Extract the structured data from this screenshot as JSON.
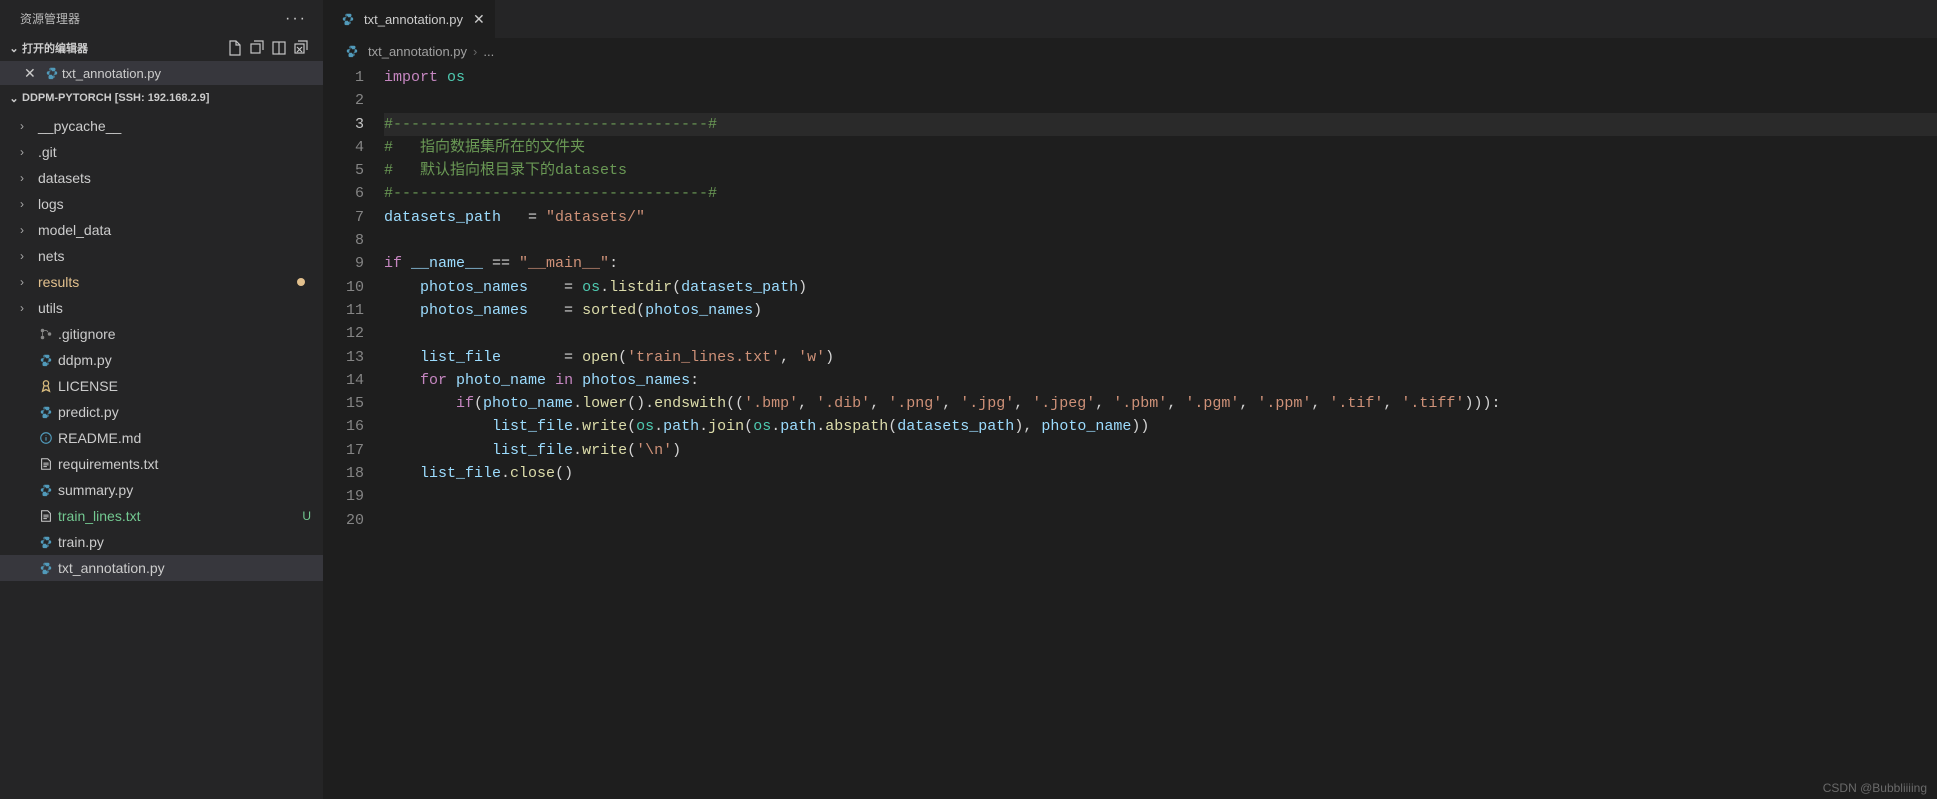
{
  "sidebar": {
    "title": "资源管理器",
    "sections": {
      "openEditors": {
        "label": "打开的编辑器",
        "item": "txt_annotation.py"
      },
      "workspace": {
        "label": "DDPM-PYTORCH [SSH: 192.168.2.9]"
      }
    },
    "folders": [
      "__pycache__",
      ".git",
      "datasets",
      "logs",
      "model_data",
      "nets",
      "results",
      "utils"
    ],
    "files": [
      {
        "name": ".gitignore",
        "icon": "git"
      },
      {
        "name": "ddpm.py",
        "icon": "py"
      },
      {
        "name": "LICENSE",
        "icon": "license"
      },
      {
        "name": "predict.py",
        "icon": "py"
      },
      {
        "name": "README.md",
        "icon": "info"
      },
      {
        "name": "requirements.txt",
        "icon": "txt"
      },
      {
        "name": "summary.py",
        "icon": "py"
      },
      {
        "name": "train_lines.txt",
        "icon": "txt",
        "status": "U"
      },
      {
        "name": "train.py",
        "icon": "py"
      },
      {
        "name": "txt_annotation.py",
        "icon": "py",
        "selected": true
      }
    ]
  },
  "tab": {
    "filename": "txt_annotation.py"
  },
  "breadcrumb": {
    "filename": "txt_annotation.py",
    "sep": "›",
    "more": "..."
  },
  "code": {
    "lines": [
      [
        {
          "t": "import ",
          "c": "kw"
        },
        {
          "t": "os",
          "c": "mod"
        }
      ],
      [],
      [
        {
          "t": "#-----------------------------------#",
          "c": "cmt"
        }
      ],
      [
        {
          "t": "#   指向数据集所在的文件夹",
          "c": "cmt"
        }
      ],
      [
        {
          "t": "#   默认指向根目录下的datasets",
          "c": "cmt"
        }
      ],
      [
        {
          "t": "#-----------------------------------#",
          "c": "cmt"
        }
      ],
      [
        {
          "t": "datasets_path   ",
          "c": "var"
        },
        {
          "t": "= ",
          "c": "op"
        },
        {
          "t": "\"datasets/\"",
          "c": "str"
        }
      ],
      [],
      [
        {
          "t": "if ",
          "c": "kw"
        },
        {
          "t": "__name__",
          "c": "var"
        },
        {
          "t": " == ",
          "c": "op"
        },
        {
          "t": "\"__main__\"",
          "c": "str"
        },
        {
          "t": ":",
          "c": "op"
        }
      ],
      [
        {
          "t": "    ",
          "c": "op"
        },
        {
          "t": "photos_names    ",
          "c": "var"
        },
        {
          "t": "= ",
          "c": "op"
        },
        {
          "t": "os",
          "c": "mod"
        },
        {
          "t": ".",
          "c": "op"
        },
        {
          "t": "listdir",
          "c": "fn"
        },
        {
          "t": "(",
          "c": "op"
        },
        {
          "t": "datasets_path",
          "c": "var"
        },
        {
          "t": ")",
          "c": "op"
        }
      ],
      [
        {
          "t": "    ",
          "c": "op"
        },
        {
          "t": "photos_names    ",
          "c": "var"
        },
        {
          "t": "= ",
          "c": "op"
        },
        {
          "t": "sorted",
          "c": "fn"
        },
        {
          "t": "(",
          "c": "op"
        },
        {
          "t": "photos_names",
          "c": "var"
        },
        {
          "t": ")",
          "c": "op"
        }
      ],
      [],
      [
        {
          "t": "    ",
          "c": "op"
        },
        {
          "t": "list_file       ",
          "c": "var"
        },
        {
          "t": "= ",
          "c": "op"
        },
        {
          "t": "open",
          "c": "fn"
        },
        {
          "t": "(",
          "c": "op"
        },
        {
          "t": "'train_lines.txt'",
          "c": "str"
        },
        {
          "t": ", ",
          "c": "op"
        },
        {
          "t": "'w'",
          "c": "str"
        },
        {
          "t": ")",
          "c": "op"
        }
      ],
      [
        {
          "t": "    ",
          "c": "op"
        },
        {
          "t": "for ",
          "c": "kw"
        },
        {
          "t": "photo_name ",
          "c": "var"
        },
        {
          "t": "in ",
          "c": "kw"
        },
        {
          "t": "photos_names",
          "c": "var"
        },
        {
          "t": ":",
          "c": "op"
        }
      ],
      [
        {
          "t": "        ",
          "c": "op"
        },
        {
          "t": "if",
          "c": "kw"
        },
        {
          "t": "(",
          "c": "op"
        },
        {
          "t": "photo_name",
          "c": "var"
        },
        {
          "t": ".",
          "c": "op"
        },
        {
          "t": "lower",
          "c": "fn"
        },
        {
          "t": "().",
          "c": "op"
        },
        {
          "t": "endswith",
          "c": "fn"
        },
        {
          "t": "((",
          "c": "op"
        },
        {
          "t": "'.bmp'",
          "c": "str"
        },
        {
          "t": ", ",
          "c": "op"
        },
        {
          "t": "'.dib'",
          "c": "str"
        },
        {
          "t": ", ",
          "c": "op"
        },
        {
          "t": "'.png'",
          "c": "str"
        },
        {
          "t": ", ",
          "c": "op"
        },
        {
          "t": "'.jpg'",
          "c": "str"
        },
        {
          "t": ", ",
          "c": "op"
        },
        {
          "t": "'.jpeg'",
          "c": "str"
        },
        {
          "t": ", ",
          "c": "op"
        },
        {
          "t": "'.pbm'",
          "c": "str"
        },
        {
          "t": ", ",
          "c": "op"
        },
        {
          "t": "'.pgm'",
          "c": "str"
        },
        {
          "t": ", ",
          "c": "op"
        },
        {
          "t": "'.ppm'",
          "c": "str"
        },
        {
          "t": ", ",
          "c": "op"
        },
        {
          "t": "'.tif'",
          "c": "str"
        },
        {
          "t": ", ",
          "c": "op"
        },
        {
          "t": "'.tiff'",
          "c": "str"
        },
        {
          "t": "))):",
          "c": "op"
        }
      ],
      [
        {
          "t": "            ",
          "c": "op"
        },
        {
          "t": "list_file",
          "c": "var"
        },
        {
          "t": ".",
          "c": "op"
        },
        {
          "t": "write",
          "c": "fn"
        },
        {
          "t": "(",
          "c": "op"
        },
        {
          "t": "os",
          "c": "mod"
        },
        {
          "t": ".",
          "c": "op"
        },
        {
          "t": "path",
          "c": "var"
        },
        {
          "t": ".",
          "c": "op"
        },
        {
          "t": "join",
          "c": "fn"
        },
        {
          "t": "(",
          "c": "op"
        },
        {
          "t": "os",
          "c": "mod"
        },
        {
          "t": ".",
          "c": "op"
        },
        {
          "t": "path",
          "c": "var"
        },
        {
          "t": ".",
          "c": "op"
        },
        {
          "t": "abspath",
          "c": "fn"
        },
        {
          "t": "(",
          "c": "op"
        },
        {
          "t": "datasets_path",
          "c": "var"
        },
        {
          "t": "), ",
          "c": "op"
        },
        {
          "t": "photo_name",
          "c": "var"
        },
        {
          "t": "))",
          "c": "op"
        }
      ],
      [
        {
          "t": "            ",
          "c": "op"
        },
        {
          "t": "list_file",
          "c": "var"
        },
        {
          "t": ".",
          "c": "op"
        },
        {
          "t": "write",
          "c": "fn"
        },
        {
          "t": "(",
          "c": "op"
        },
        {
          "t": "'\\n'",
          "c": "str"
        },
        {
          "t": ")",
          "c": "op"
        }
      ],
      [
        {
          "t": "    ",
          "c": "op"
        },
        {
          "t": "list_file",
          "c": "var"
        },
        {
          "t": ".",
          "c": "op"
        },
        {
          "t": "close",
          "c": "fn"
        },
        {
          "t": "()",
          "c": "op"
        }
      ],
      [],
      []
    ],
    "activeLine": 3
  },
  "watermark": "CSDN @Bubbliiiing"
}
